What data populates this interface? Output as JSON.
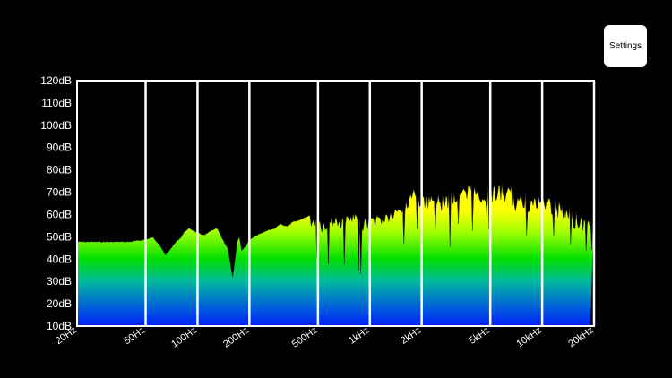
{
  "toolbar": {
    "settings_label": "Settings"
  },
  "colors": {
    "background": "#000000",
    "frame": "#ffffff",
    "fill_top": "#ffff00",
    "fill_mid": "#00e000",
    "fill_bottom": "#0020ff"
  },
  "chart_data": {
    "type": "area",
    "title": "",
    "y_axis": {
      "min": 10,
      "max": 120,
      "ticks": [
        10,
        20,
        30,
        40,
        50,
        60,
        70,
        80,
        90,
        100,
        110,
        120
      ],
      "tick_labels": [
        "10dB",
        "20dB",
        "30dB",
        "40dB",
        "50dB",
        "60dB",
        "70dB",
        "80dB",
        "90dB",
        "100dB",
        "110dB",
        "120dB"
      ]
    },
    "x_axis": {
      "scale": "log",
      "min": 20,
      "max": 20000,
      "ticks": [
        20,
        50,
        100,
        200,
        500,
        1000,
        2000,
        5000,
        10000,
        20000
      ],
      "tick_labels": [
        "20Hz",
        "50Hz",
        "100Hz",
        "200Hz",
        "500Hz",
        "1kHz",
        "2kHz",
        "5kHz",
        "10kHz",
        "20kHz"
      ]
    },
    "grid": true,
    "series": [
      {
        "x": [
          20,
          30,
          40,
          50,
          55,
          60,
          65,
          70,
          75,
          80,
          85,
          90,
          95,
          100,
          110,
          120,
          130,
          140,
          150,
          160,
          165,
          170,
          175,
          180,
          190,
          200,
          220,
          250,
          280,
          300,
          330,
          360,
          400,
          450,
          500,
          550,
          600,
          700,
          800,
          900,
          1000,
          1200,
          1400,
          1600,
          1800,
          2000,
          2500,
          3000,
          3500,
          4000,
          4500,
          5000,
          6000,
          7000,
          8000,
          9000,
          10000,
          12000,
          14000,
          16000,
          18000,
          20000
        ],
        "y": [
          48,
          48,
          48,
          49,
          50,
          47,
          42,
          45,
          48,
          50,
          53,
          54,
          53,
          52,
          51,
          53,
          54,
          49,
          45,
          32,
          40,
          48,
          50,
          44,
          46,
          49,
          51,
          53,
          54,
          56,
          55,
          57,
          58,
          60,
          59,
          57,
          60,
          59,
          61,
          58,
          60,
          61,
          63,
          67,
          72,
          68,
          70,
          72,
          73,
          74,
          73,
          74,
          74,
          72,
          70,
          69,
          70,
          68,
          64,
          62,
          60,
          59
        ]
      }
    ]
  }
}
